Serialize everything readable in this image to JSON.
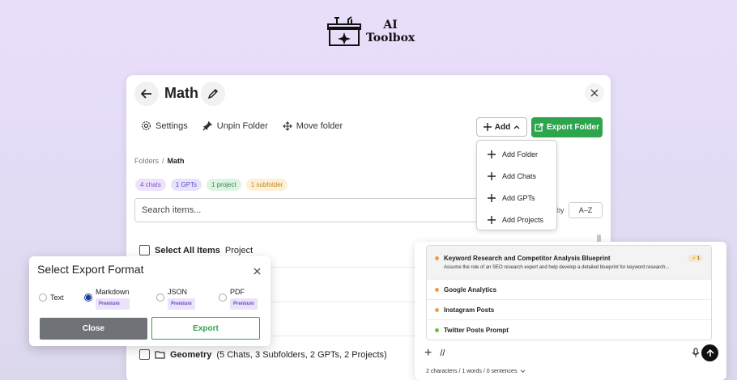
{
  "logo": {
    "line1": "AI",
    "line2": "Toolbox"
  },
  "panel": {
    "title": "Math",
    "toolbar": {
      "settings": "Settings",
      "unpin_folder": "Unpin Folder",
      "move_folder": "Move folder",
      "add": "Add",
      "export_folder": "Export Folder"
    },
    "breadcrumb": {
      "root": "Folders",
      "separator": "/",
      "current": "Math"
    },
    "tags": [
      {
        "label": "4 chats",
        "bg": "#ece3fb",
        "fg": "#7a57c8"
      },
      {
        "label": "1 GPTs",
        "bg": "#e6e2fb",
        "fg": "#5a4fc0"
      },
      {
        "label": "1 project",
        "bg": "#dff3e3",
        "fg": "#2f8a45"
      },
      {
        "label": "1 subfolder",
        "bg": "#fdf0d6",
        "fg": "#c2861a"
      }
    ],
    "search": {
      "placeholder": "Search items..."
    },
    "sort": {
      "label": "by",
      "value": "A–Z"
    },
    "select_all": {
      "label": "Select All Items",
      "suffix": "Project"
    },
    "geometry_row": {
      "name": "Geometry",
      "details": "(5 Chats, 3 Subfolders, 2 GPTs, 2 Projects)"
    }
  },
  "add_menu": {
    "items": [
      "Add Folder",
      "Add Chats",
      "Add GPTs",
      "Add Projects"
    ]
  },
  "export_dialog": {
    "title": "Select Export Format",
    "formats": [
      {
        "label": "Text",
        "premium": "",
        "selected": false
      },
      {
        "label": "Markdown",
        "premium": "Premium",
        "selected": true
      },
      {
        "label": "JSON",
        "premium": "Premium",
        "selected": false
      },
      {
        "label": "PDF",
        "premium": "Premium",
        "selected": false
      }
    ],
    "close_label": "Close",
    "export_label": "Export"
  },
  "prompt_widget": {
    "items": [
      {
        "title": "Keyword Research and Competitor Analysis Blueprint",
        "desc": "Assume the role of an SEO research expert and help develop a detailed blueprint for keyword research...",
        "badge": "⚡1",
        "dot": "#e8a33c"
      },
      {
        "title": "Google Analytics",
        "dot": "#e8a33c"
      },
      {
        "title": "Instagram Posts",
        "dot": "#e8a33c"
      },
      {
        "title": "Twitter Posts Prompt",
        "dot": "#6cbf4a"
      }
    ],
    "input_value": "//",
    "stats": "2 characters / 1 words / 0 sentences"
  }
}
